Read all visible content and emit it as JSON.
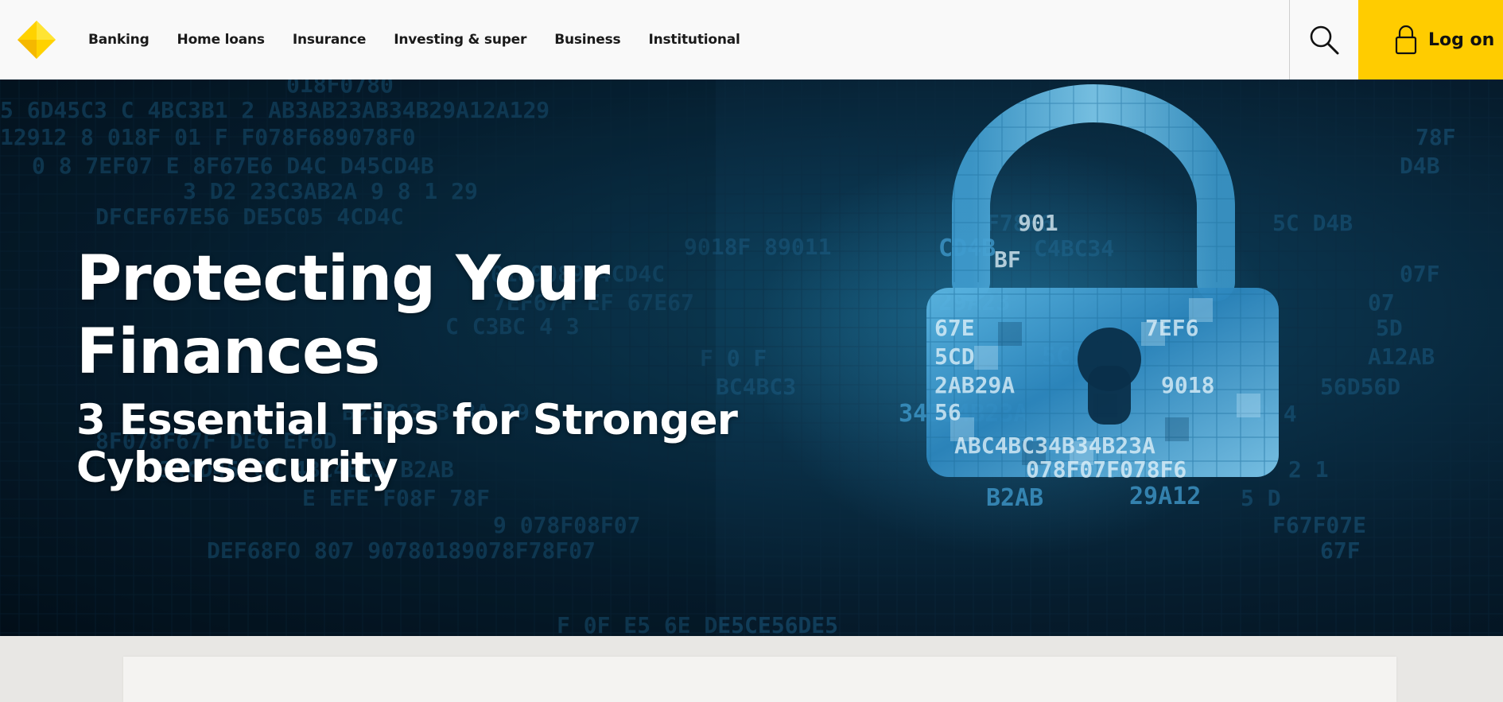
{
  "header": {
    "logo_icon": "commbank-diamond-logo",
    "nav": [
      {
        "label": "Banking"
      },
      {
        "label": "Home loans"
      },
      {
        "label": "Insurance"
      },
      {
        "label": "Investing & super"
      },
      {
        "label": "Business"
      },
      {
        "label": "Institutional"
      }
    ],
    "search_icon": "search-icon",
    "logon": {
      "label": "Log on",
      "icon": "padlock-icon"
    }
  },
  "hero": {
    "title": "Protecting Your Finances",
    "subtitle": "3 Essential Tips for Stronger Cybersecurity",
    "image_icon": "padlock-icon"
  },
  "colors": {
    "brand_yellow": "#ffcc00",
    "header_bg": "#f9f9f9",
    "hero_dark": "#061d2e",
    "hero_accent": "#2f8fc4",
    "page_bg": "#e8e7e4",
    "card_bg": "#f4f3f1"
  }
}
